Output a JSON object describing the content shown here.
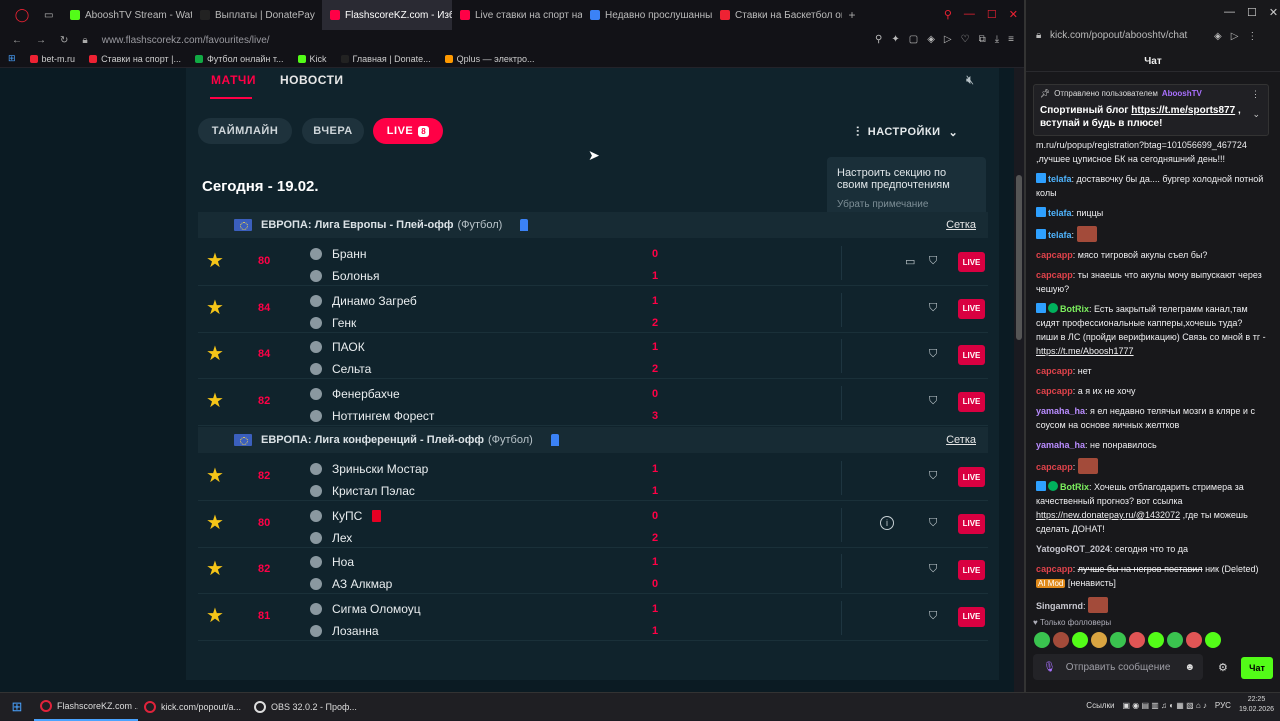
{
  "browser": {
    "tabs": [
      {
        "label": "AbooshTV Stream - Watch",
        "color": "#53fc18"
      },
      {
        "label": "Выплаты | DonatePay",
        "color": "#222"
      },
      {
        "label": "FlashscoreKZ.com - Избр",
        "color": "#ff0046",
        "active": true
      },
      {
        "label": "Live ставки на спорт на",
        "color": "#ff0046"
      },
      {
        "label": "Недавно прослушанные",
        "color": "#3b82f6"
      },
      {
        "label": "Ставки на Баскетбол онл",
        "color": "#e23"
      }
    ],
    "url": "www.flashscorekz.com/favourites/live/",
    "bookmarks": [
      {
        "label": "bet-m.ru",
        "color": "#e23"
      },
      {
        "label": "Ставки на спорт |...",
        "color": "#e23"
      },
      {
        "label": "Футбол онлайн т...",
        "color": "#1a4"
      },
      {
        "label": "Kick",
        "color": "#53fc18"
      },
      {
        "label": "Главная | Donate...",
        "color": "#222"
      },
      {
        "label": "Qplus — электро...",
        "color": "#f90"
      }
    ]
  },
  "flashscore": {
    "nav": {
      "matches": "МАТЧИ",
      "news": "НОВОСТИ"
    },
    "filters": {
      "timeline": "ТАЙМЛАЙН",
      "yesterday": "ВЧЕРА",
      "live": "LIVE",
      "live_count": "8"
    },
    "settings": "НАСТРОЙКИ",
    "tooltip": {
      "text": "Настроить секцию по своим предпочтениям",
      "remove": "Убрать примечание"
    },
    "date": "Сегодня - 19.02.",
    "leagues": [
      {
        "name": "ЕВРОПА: Лига Европы - Плей-офф",
        "sport": "(Футбол)",
        "grid": "Сетка",
        "matches": [
          {
            "minute": "80",
            "home": "Бранн",
            "away": "Болонья",
            "hs": "0",
            "as": "1",
            "tv": true,
            "info": false,
            "red": false
          },
          {
            "minute": "84",
            "home": "Динамо Загреб",
            "away": "Генк",
            "hs": "1",
            "as": "2",
            "tv": false,
            "info": false,
            "red": false
          },
          {
            "minute": "84",
            "home": "ПАОК",
            "away": "Сельта",
            "hs": "1",
            "as": "2",
            "tv": false,
            "info": false,
            "red": false
          },
          {
            "minute": "82",
            "home": "Фенербахче",
            "away": "Ноттингем Форест",
            "hs": "0",
            "as": "3",
            "tv": false,
            "info": false,
            "red": false
          }
        ]
      },
      {
        "name": "ЕВРОПА: Лига конференций - Плей-офф",
        "sport": "(Футбол)",
        "grid": "Сетка",
        "matches": [
          {
            "minute": "82",
            "home": "Зриньски Мостар",
            "away": "Кристал Пэлас",
            "hs": "1",
            "as": "1",
            "tv": false,
            "info": false,
            "red": false
          },
          {
            "minute": "80",
            "home": "КуПС",
            "away": "Лех",
            "hs": "0",
            "as": "2",
            "tv": false,
            "info": true,
            "red": true
          },
          {
            "minute": "82",
            "home": "Ноа",
            "away": "АЗ Алкмар",
            "hs": "1",
            "as": "0",
            "tv": false,
            "info": false,
            "red": false
          },
          {
            "minute": "81",
            "home": "Сигма Оломоуц",
            "away": "Лозанна",
            "hs": "1",
            "as": "1",
            "tv": false,
            "info": false,
            "red": false
          }
        ]
      }
    ],
    "live_label": "LIVE",
    "info_glyph": "i"
  },
  "chat": {
    "url": "kick.com/popout/abooshtv/chat",
    "title": "Чат",
    "pinned": {
      "by": "Отправлено пользователем",
      "user": "AbooshTV",
      "text_pre": "Спортивный блог ",
      "link": "https://t.me/sports877",
      "text_post": " , вступай и будь в плюсе!"
    },
    "messages": [
      {
        "nick": "",
        "text": "m.ru/ru/popup/registration?btag=101056699_467724 ,лучшее цуписное БК на сегодняшний день!!!"
      },
      {
        "nick": "telafa",
        "color": "#4fb5ff",
        "text": "доставочку бы да.... бургер холодной потной колы",
        "ico": true
      },
      {
        "nick": "telafa",
        "color": "#4fb5ff",
        "text": "пиццы",
        "ico": true
      },
      {
        "nick": "telafa",
        "color": "#4fb5ff",
        "text": "",
        "ico": true,
        "emote": true
      },
      {
        "nick": "сарсарр",
        "color": "#e0434b",
        "text": "мясо тигровой акулы съел бы?"
      },
      {
        "nick": "сарсарр",
        "color": "#e0434b",
        "text": "ты знаешь что акулы мочу выпускают через чешую?"
      },
      {
        "nick": "BotRix",
        "color": "#7cf05e",
        "text": "Есть закрытый телеграмм канал,там сидят профессиональные капперы,хочешь туда? пиши в ЛС (пройди верификацию) Связь со мной в тг - ",
        "link": "https://t.me/Aboosh1777",
        "ico": true,
        "bot": true
      },
      {
        "nick": "сарсарр",
        "color": "#e0434b",
        "text": "нет"
      },
      {
        "nick": "сарсарр",
        "color": "#e0434b",
        "text": "а я их не хочу"
      },
      {
        "nick": "yamaha_ha",
        "color": "#b98cff",
        "text": "я ел недавно телячьи мозги в кляре и с соусом на основе яичных желтков"
      },
      {
        "nick": "yamaha_ha",
        "color": "#b98cff",
        "text": "не понравилось"
      },
      {
        "nick": "сарсарр",
        "color": "#e0434b",
        "text": "",
        "emote": true
      },
      {
        "nick": "BotRix",
        "color": "#7cf05e",
        "text": "Хочешь отблагодарить стримера за качественный прогноз? вот ссылка ",
        "link": "https://new.donatepay.ru/@1432072",
        "text2": " ,где ты можешь сделать ДОНАТ!",
        "ico": true,
        "bot": true
      },
      {
        "nick": "YatogoROT_2024",
        "color": "#c7c7cf",
        "text": "сегодня что то да"
      },
      {
        "nick": "сарсарр",
        "color": "#e0434b",
        "strike": "лучше бы на негров поставил",
        "deleted": "ник (Deleted)",
        "aimod": "AI Mod",
        "tail": "[ненависть]"
      },
      {
        "nick": "Singamrnd",
        "color": "#c7c7cf",
        "text": "",
        "emote": true
      }
    ],
    "followers_only": "Только фолловеры",
    "input_placeholder": "Отправить сообщение",
    "send": "Чат"
  },
  "taskbar": {
    "items": [
      "FlashscoreKZ.com ...",
      "kick.com/popout/a...",
      "OBS 32.0.2 - Проф..."
    ],
    "links": "Ссылки",
    "lang": "РУС",
    "time": "22:25",
    "date": "19.02.2026"
  }
}
